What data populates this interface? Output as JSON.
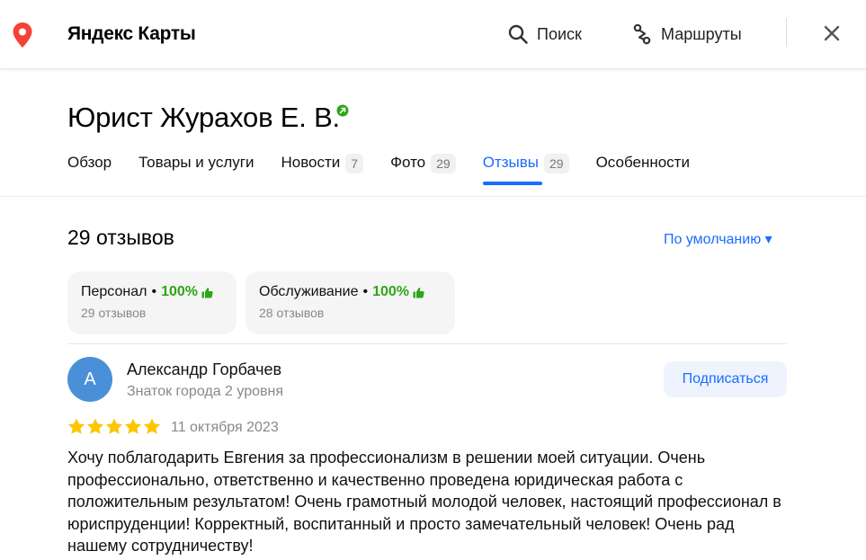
{
  "header": {
    "logo": "Яндекс Карты",
    "search_label": "Поиск",
    "routes_label": "Маршруты"
  },
  "org": {
    "title": "Юрист Журахов Е. В."
  },
  "tabs": [
    {
      "label": "Обзор",
      "count": ""
    },
    {
      "label": "Товары и услуги",
      "count": ""
    },
    {
      "label": "Новости",
      "count": "7"
    },
    {
      "label": "Фото",
      "count": "29"
    },
    {
      "label": "Отзывы",
      "count": "29",
      "active": true
    },
    {
      "label": "Особенности",
      "count": ""
    }
  ],
  "reviews": {
    "count_label": "29 отзывов",
    "sort_label": "По умолчанию ▾",
    "aspects": [
      {
        "name": "Персонал",
        "percent": "100%",
        "count": "29 отзывов"
      },
      {
        "name": "Обслуживание",
        "percent": "100%",
        "count": "28 отзывов"
      }
    ],
    "items": [
      {
        "avatar_letter": "А",
        "author": "Александр Горбачев",
        "level": "Знаток города 2 уровня",
        "subscribe_label": "Подписаться",
        "rating": 5,
        "date": "11 октября 2023",
        "text": "Хочу поблагодарить Евгения за профессионализм в решении моей ситуации. Очень профессионально, ответственно и качественно проведена юридическая работа с положительным результатом! Очень грамотный молодой человек, настоящий профессионал в юриспруденции! Корректный, воспитанный и просто замечательный человек! Очень рад нашему сотрудничеству!"
      }
    ]
  },
  "colors": {
    "accent": "#196dff",
    "positive": "#2fa518",
    "star": "#fcc600",
    "pin": "#f44336",
    "avatar": "#4a90d9"
  }
}
